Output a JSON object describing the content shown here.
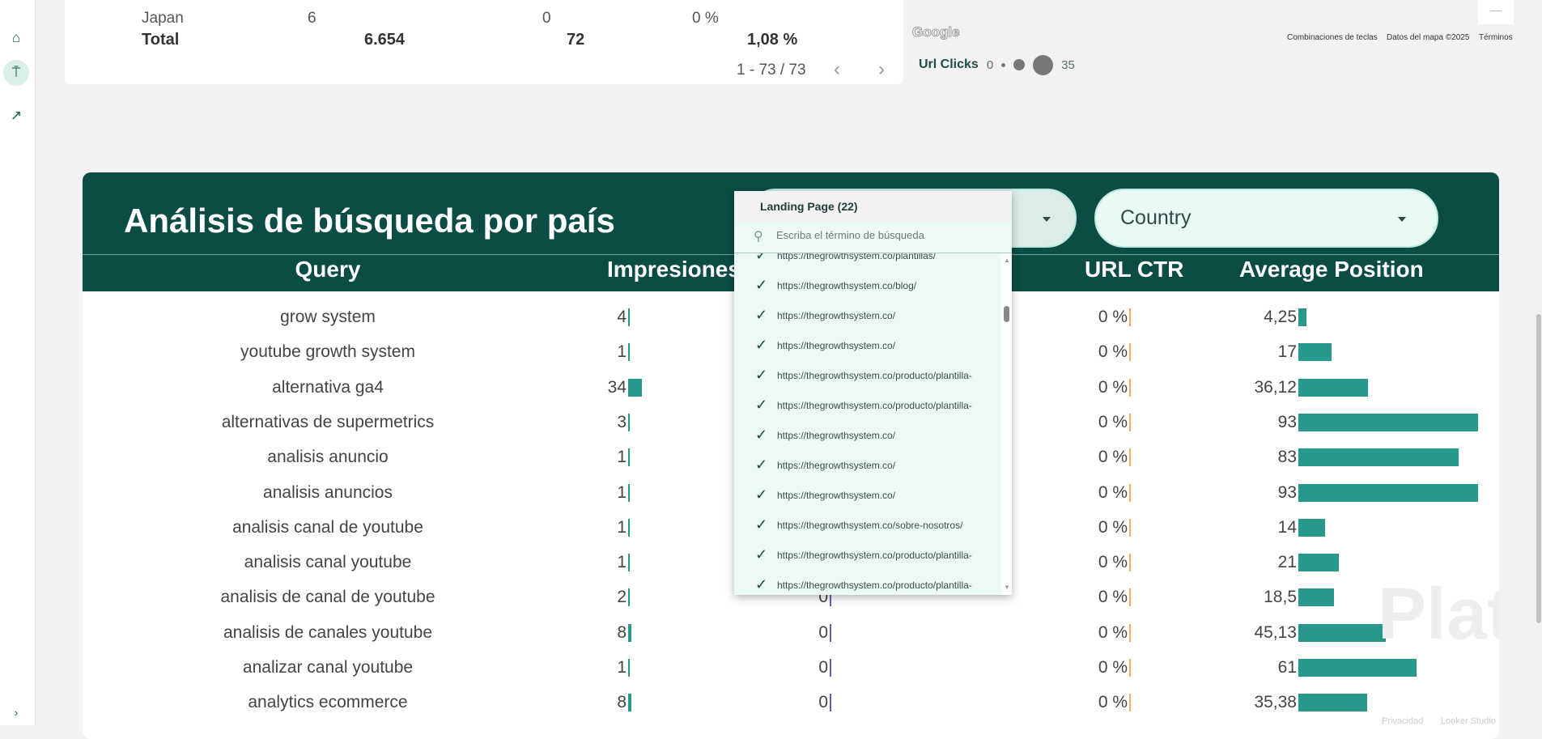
{
  "sidebar": {
    "items": [
      {
        "icon": "home-icon"
      },
      {
        "icon": "pin-icon"
      },
      {
        "icon": "trending-icon"
      }
    ],
    "expand_icon": "chevron-right-icon"
  },
  "top_table": {
    "partial_row": {
      "label": "Japan",
      "impressions": "6",
      "clicks": "0",
      "ctr": "0 %"
    },
    "total": {
      "label": "Total",
      "impressions": "6.654",
      "clicks": "72",
      "ctr": "1,08 %"
    },
    "pagination": "1 - 73 / 73"
  },
  "map": {
    "logo": "Google",
    "shortcuts": "Combinaciones de teclas",
    "map_data": "Datos del mapa ©2025",
    "terms": "Términos",
    "zoom_out": "—",
    "legend": {
      "label": "Url Clicks",
      "min": "0",
      "max": "35"
    }
  },
  "panel": {
    "title": "Análisis de búsqueda por país",
    "country_filter": "Country",
    "columns": {
      "query": "Query",
      "impressions": "Impresiones",
      "url_ctr": "URL CTR",
      "average_position": "Average Position"
    },
    "rows": [
      {
        "query": "grow system",
        "impressions": 4,
        "clicks": "",
        "ctr": "0 %",
        "position": "4,25",
        "position_value": 4.25
      },
      {
        "query": "youtube growth system",
        "impressions": 1,
        "clicks": "",
        "ctr": "0 %",
        "position": "17",
        "position_value": 17
      },
      {
        "query": "alternativa ga4",
        "impressions": 34,
        "clicks": "",
        "ctr": "0 %",
        "position": "36,12",
        "position_value": 36.12
      },
      {
        "query": "alternativas de supermetrics",
        "impressions": 3,
        "clicks": "",
        "ctr": "0 %",
        "position": "93",
        "position_value": 93
      },
      {
        "query": "analisis anuncio",
        "impressions": 1,
        "clicks": "",
        "ctr": "0 %",
        "position": "83",
        "position_value": 83
      },
      {
        "query": "analisis anuncios",
        "impressions": 1,
        "clicks": "",
        "ctr": "0 %",
        "position": "93",
        "position_value": 93
      },
      {
        "query": "analisis canal de youtube",
        "impressions": 1,
        "clicks": "",
        "ctr": "0 %",
        "position": "14",
        "position_value": 14
      },
      {
        "query": "analisis canal youtube",
        "impressions": 1,
        "clicks": "",
        "ctr": "0 %",
        "position": "21",
        "position_value": 21
      },
      {
        "query": "analisis de canal de youtube",
        "impressions": 2,
        "clicks": "0",
        "ctr": "0 %",
        "position": "18,5",
        "position_value": 18.5
      },
      {
        "query": "analisis de canales youtube",
        "impressions": 8,
        "clicks": "0",
        "ctr": "0 %",
        "position": "45,13",
        "position_value": 45.13
      },
      {
        "query": "analizar canal youtube",
        "impressions": 1,
        "clicks": "0",
        "ctr": "0 %",
        "position": "61",
        "position_value": 61
      },
      {
        "query": "analytics ecommerce",
        "impressions": 8,
        "clicks": "0",
        "ctr": "0 %",
        "position": "35,38",
        "position_value": 35.38
      }
    ],
    "footer": {
      "privacy": "Privacidad",
      "looker": "Looker Studio"
    },
    "watermark": "Platzi"
  },
  "dropdown": {
    "title": "Landing Page (22)",
    "search_placeholder": "Escriba el término de búsqueda",
    "items": [
      "https://thegrowthsystem.co/plantillas/",
      "https://thegrowthsystem.co/blog/",
      "https://thegrowthsystem.co/",
      "https://thegrowthsystem.co/",
      "https://thegrowthsystem.co/producto/plantilla-",
      "https://thegrowthsystem.co/producto/plantilla-",
      "https://thegrowthsystem.co/",
      "https://thegrowthsystem.co/",
      "https://thegrowthsystem.co/",
      "https://thegrowthsystem.co/sobre-nosotros/",
      "https://thegrowthsystem.co/producto/plantilla-",
      "https://thegrowthsystem.co/producto/plantilla-"
    ]
  },
  "colors": {
    "header": "#0b4c45",
    "bar": "#26998a",
    "ctr_bar": "#f0b060",
    "clicks_bar": "#6a5aa8",
    "pill": "#e9f9f4"
  }
}
